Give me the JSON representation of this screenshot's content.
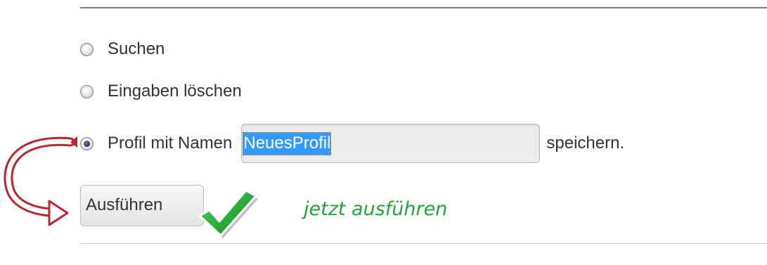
{
  "options": [
    {
      "label": "Suchen",
      "checked": false
    },
    {
      "label": "Eingaben löschen",
      "checked": false
    },
    {
      "label_before": "Profil mit Namen",
      "label_after": "speichern.",
      "checked": true
    }
  ],
  "profile_name": {
    "value": "NeuesProfil",
    "selected": true
  },
  "run_button": {
    "label": "Ausführen"
  },
  "annotation": {
    "text": "jetzt ausführen",
    "text_color": "#22a63a",
    "arrow_color": "#b5272d",
    "check_icon": "green-check-icon",
    "arrow_icon": "curved-arrow-icon"
  }
}
